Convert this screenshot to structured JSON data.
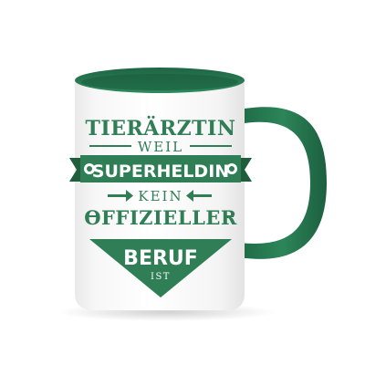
{
  "product": {
    "body_color": "#ffffff",
    "accent_color": "#2a7a52",
    "print_color": "#2f7e55",
    "print_dark_color": "#1f5d3d"
  },
  "print": {
    "line1": "TIERÄRZTIN",
    "line2": "WEIL",
    "banner": "SUPERHELDIN",
    "line3": "KEIN",
    "line4": "OFFIZIELLER",
    "triangle_word": "BERUF",
    "triangle_sub": "IST"
  }
}
